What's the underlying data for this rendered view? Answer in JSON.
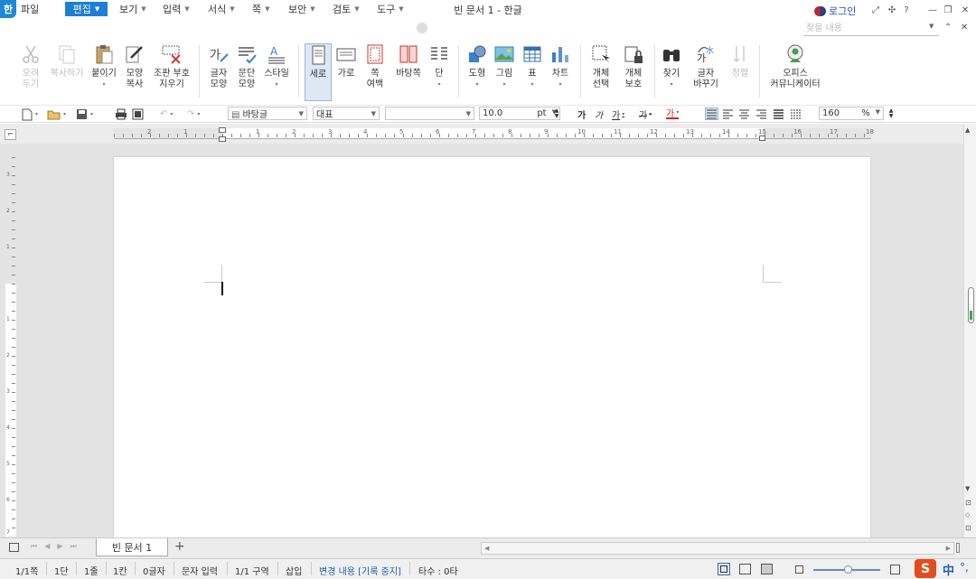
{
  "window": {
    "app_logo": "한",
    "title": "빈 문서 1 - 한글",
    "login_label": "로그인",
    "title_buttons": [
      "⤢",
      "✣",
      "?",
      "—",
      "❐",
      "✕"
    ]
  },
  "menubar": {
    "items": [
      {
        "label": "파일",
        "has_arrow": false
      },
      {
        "label": "편집",
        "has_arrow": true,
        "active": true
      },
      {
        "label": "보기",
        "has_arrow": true
      },
      {
        "label": "입력",
        "has_arrow": true
      },
      {
        "label": "서식",
        "has_arrow": true
      },
      {
        "label": "쪽",
        "has_arrow": true
      },
      {
        "label": "보안",
        "has_arrow": true
      },
      {
        "label": "검토",
        "has_arrow": true
      },
      {
        "label": "도구",
        "has_arrow": true
      }
    ],
    "search_placeholder": "찾을 내용",
    "ribbon_collapse": "⌃",
    "window_close": "✕"
  },
  "ribbon": {
    "cut": {
      "line1": "오려",
      "line2": "두기"
    },
    "copy": {
      "line1": "복사하기",
      "line2": ""
    },
    "paste": {
      "line1": "붙이기",
      "line2": "▾"
    },
    "format_copy": {
      "line1": "모양",
      "line2": "복사"
    },
    "clear_marks": {
      "line1": "조판 부호",
      "line2": "지우기"
    },
    "char_shape": {
      "line1": "글자",
      "line2": "모양"
    },
    "para_shape": {
      "line1": "문단",
      "line2": "모양"
    },
    "style": {
      "line1": "스타일",
      "line2": "▾"
    },
    "portrait": {
      "line1": "세로",
      "line2": ""
    },
    "landscape": {
      "line1": "가로",
      "line2": ""
    },
    "page_margin": {
      "line1": "쪽",
      "line2": "여백"
    },
    "bg_page": {
      "line1": "바탕쪽",
      "line2": ""
    },
    "columns": {
      "line1": "단",
      "line2": "▾"
    },
    "shape": {
      "line1": "도형",
      "line2": "▾"
    },
    "picture": {
      "line1": "그림",
      "line2": "▾"
    },
    "table": {
      "line1": "표",
      "line2": "▾"
    },
    "chart": {
      "line1": "차트",
      "line2": "▾"
    },
    "obj_select": {
      "line1": "개체",
      "line2": "선택"
    },
    "obj_protect": {
      "line1": "개체",
      "line2": "보호"
    },
    "find": {
      "line1": "찾기",
      "line2": "▾"
    },
    "replace_char": {
      "line1": "글자",
      "line2": "바꾸기"
    },
    "sort": {
      "line1": "정렬",
      "line2": ""
    },
    "office_community": {
      "line1": "오피스",
      "line2": "커뮤니케이터"
    }
  },
  "toolbar2": {
    "style_value": "바탕글",
    "lang_value": "대표",
    "font_value": "",
    "size_value": "10.0",
    "size_unit": "pt",
    "zoom_value": "160",
    "zoom_unit": "%",
    "bold_glyph": "가",
    "italic_glyph": "가",
    "underline_glyph": "가",
    "strike_glyph": "가",
    "color_glyph": "가"
  },
  "ruler": {
    "h_ticks": [
      "2",
      "1",
      "",
      "1",
      "2",
      "3",
      "4",
      "5",
      "6",
      "7",
      "8",
      "9",
      "10",
      "11",
      "12",
      "13",
      "14",
      "15",
      "16",
      "17",
      "18"
    ],
    "v_ticks": [
      "3",
      "2",
      "1",
      "",
      "1",
      "2",
      "3",
      "4",
      "5",
      "6",
      "7"
    ]
  },
  "tabs": {
    "doc_tab": "빈 문서 1",
    "add_tab": "+"
  },
  "status": {
    "page": "1/1쪽",
    "column": "1단",
    "line": "1줄",
    "col_pos": "1칸",
    "char_count": "0글자",
    "input_mode": "문자 입력",
    "section": "1/1 구역",
    "insert_mode": "삽입",
    "track_changes": "변경 내용 [기록 중지]",
    "typing_count": "타수 : 0타"
  },
  "ime": {
    "logo": "S",
    "lang": "中",
    "punct": "°,"
  },
  "colors": {
    "accent": "#1b7fd3",
    "page_bg": "#e3e3e3",
    "ime_brand": "#e24d1f"
  }
}
